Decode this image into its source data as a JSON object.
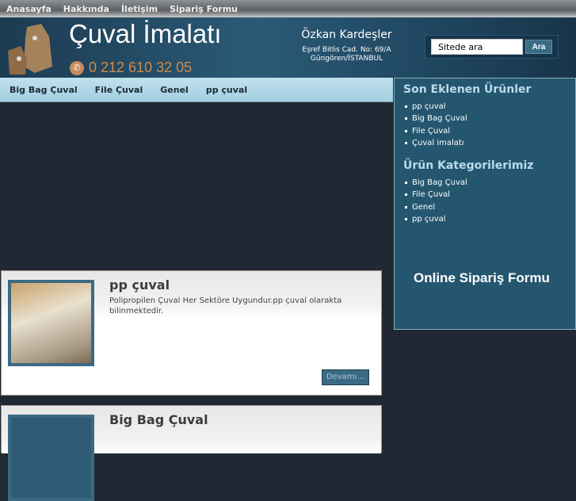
{
  "topnav": [
    "Anasayfa",
    "Hakkında",
    "İletişim",
    "Sipariş Formu"
  ],
  "header": {
    "title": "Çuval İmalatı",
    "phone": "0 212 610 32 05",
    "company": "Özkan Kardeşler",
    "address1": "Eşref Bitlis Cad. No: 69/A",
    "address2": "Güngören/İSTANBUL"
  },
  "search": {
    "value": "Sitede ara",
    "button": "Ara"
  },
  "nav": [
    "Big Bag Çuval",
    "File Çuval",
    "Genel",
    "pp çuval"
  ],
  "sidebar": {
    "recent_title": "Son Eklenen Ürünler",
    "recent": [
      "pp çuval",
      "Big Bag Çuval",
      "File Çuval",
      "Çuval imalatı"
    ],
    "cat_title": "Ürün Kategorilerimiz",
    "cats": [
      "Big Bag Çuval",
      "File Çuval",
      "Genel",
      "pp çuval"
    ],
    "order": "Online Sipariş Formu"
  },
  "posts": [
    {
      "title": "pp çuval",
      "desc": "Polipropilen Çuval Her Sektöre Uygundur.pp çuval olarakta bilinmektedir.",
      "more": "Devamı..."
    },
    {
      "title": "Big Bag Çuval"
    }
  ]
}
